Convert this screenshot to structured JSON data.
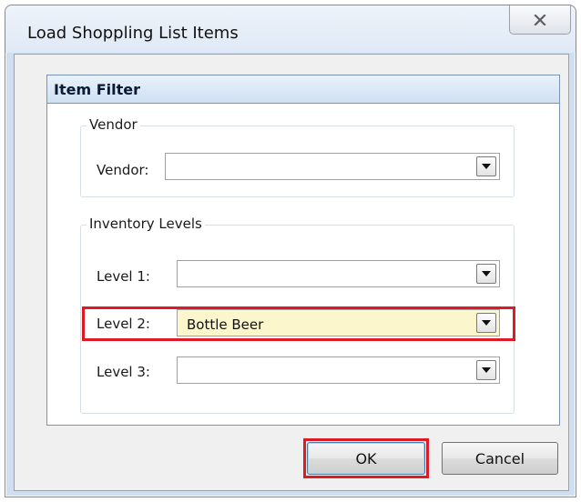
{
  "window": {
    "title": "Load Shoppling List Items",
    "close_icon": "close-icon"
  },
  "item_filter": {
    "header": "Item Filter",
    "vendor_group": {
      "title": "Vendor",
      "vendor_label": "Vendor:",
      "vendor_value": ""
    },
    "inventory_group": {
      "title": "Inventory Levels",
      "levels": [
        {
          "label": "Level 1:",
          "value": ""
        },
        {
          "label": "Level 2:",
          "value": "Bottle Beer"
        },
        {
          "label": "Level 3:",
          "value": ""
        }
      ]
    }
  },
  "buttons": {
    "ok_label": "OK",
    "cancel_label": "Cancel"
  },
  "colors": {
    "highlight": "#e01a24",
    "selected_field": "#fbf6cc",
    "panel_header": "#cfe0f4"
  }
}
